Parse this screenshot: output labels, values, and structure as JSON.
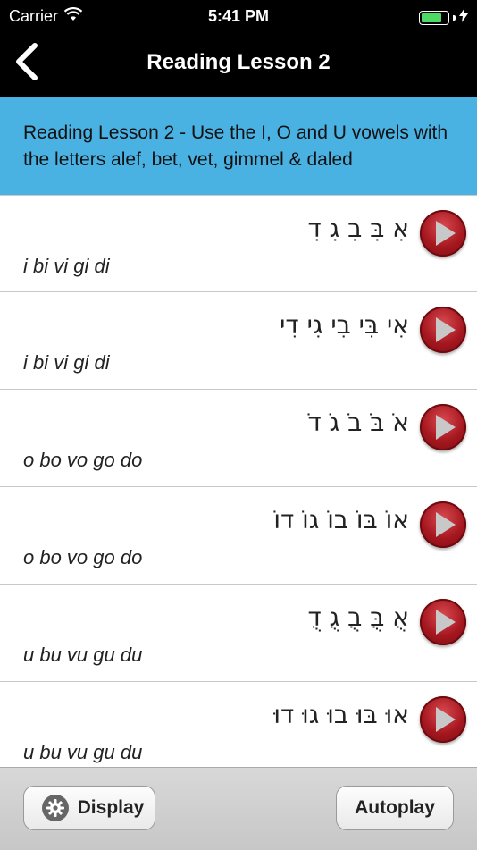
{
  "status_bar": {
    "carrier": "Carrier",
    "time": "5:41 PM",
    "battery_color": "#4cd964"
  },
  "nav": {
    "title": "Reading Lesson 2",
    "back_icon": "chevron-left-icon"
  },
  "banner": {
    "text": "Reading Lesson 2 - Use the I, O and U vowels with the letters alef, bet, vet, gimmel & daled",
    "background": "#4ab1e3"
  },
  "lessons": [
    {
      "hebrew": "אִ בִּ בִ גִ דִ",
      "translit": "i bi vi gi di"
    },
    {
      "hebrew": "אִי בִּי בִי גִי דִי",
      "translit": "i bi vi gi di"
    },
    {
      "hebrew": "אֹ בֹּ בֹ גֹ דֹ",
      "translit": "o bo vo go do"
    },
    {
      "hebrew": "אוֹ בּוֹ בוֹ גוֹ דוֹ",
      "translit": "o bo vo go do"
    },
    {
      "hebrew": "אֻ בֻּ בֻ גֻ דֻ",
      "translit": "u bu vu gu du"
    },
    {
      "hebrew": "אוּ בּוּ בוּ גוּ דוּ",
      "translit": "u bu vu gu du"
    }
  ],
  "toolbar": {
    "display_label": "Display",
    "autoplay_label": "Autoplay",
    "display_icon": "gear-icon"
  }
}
